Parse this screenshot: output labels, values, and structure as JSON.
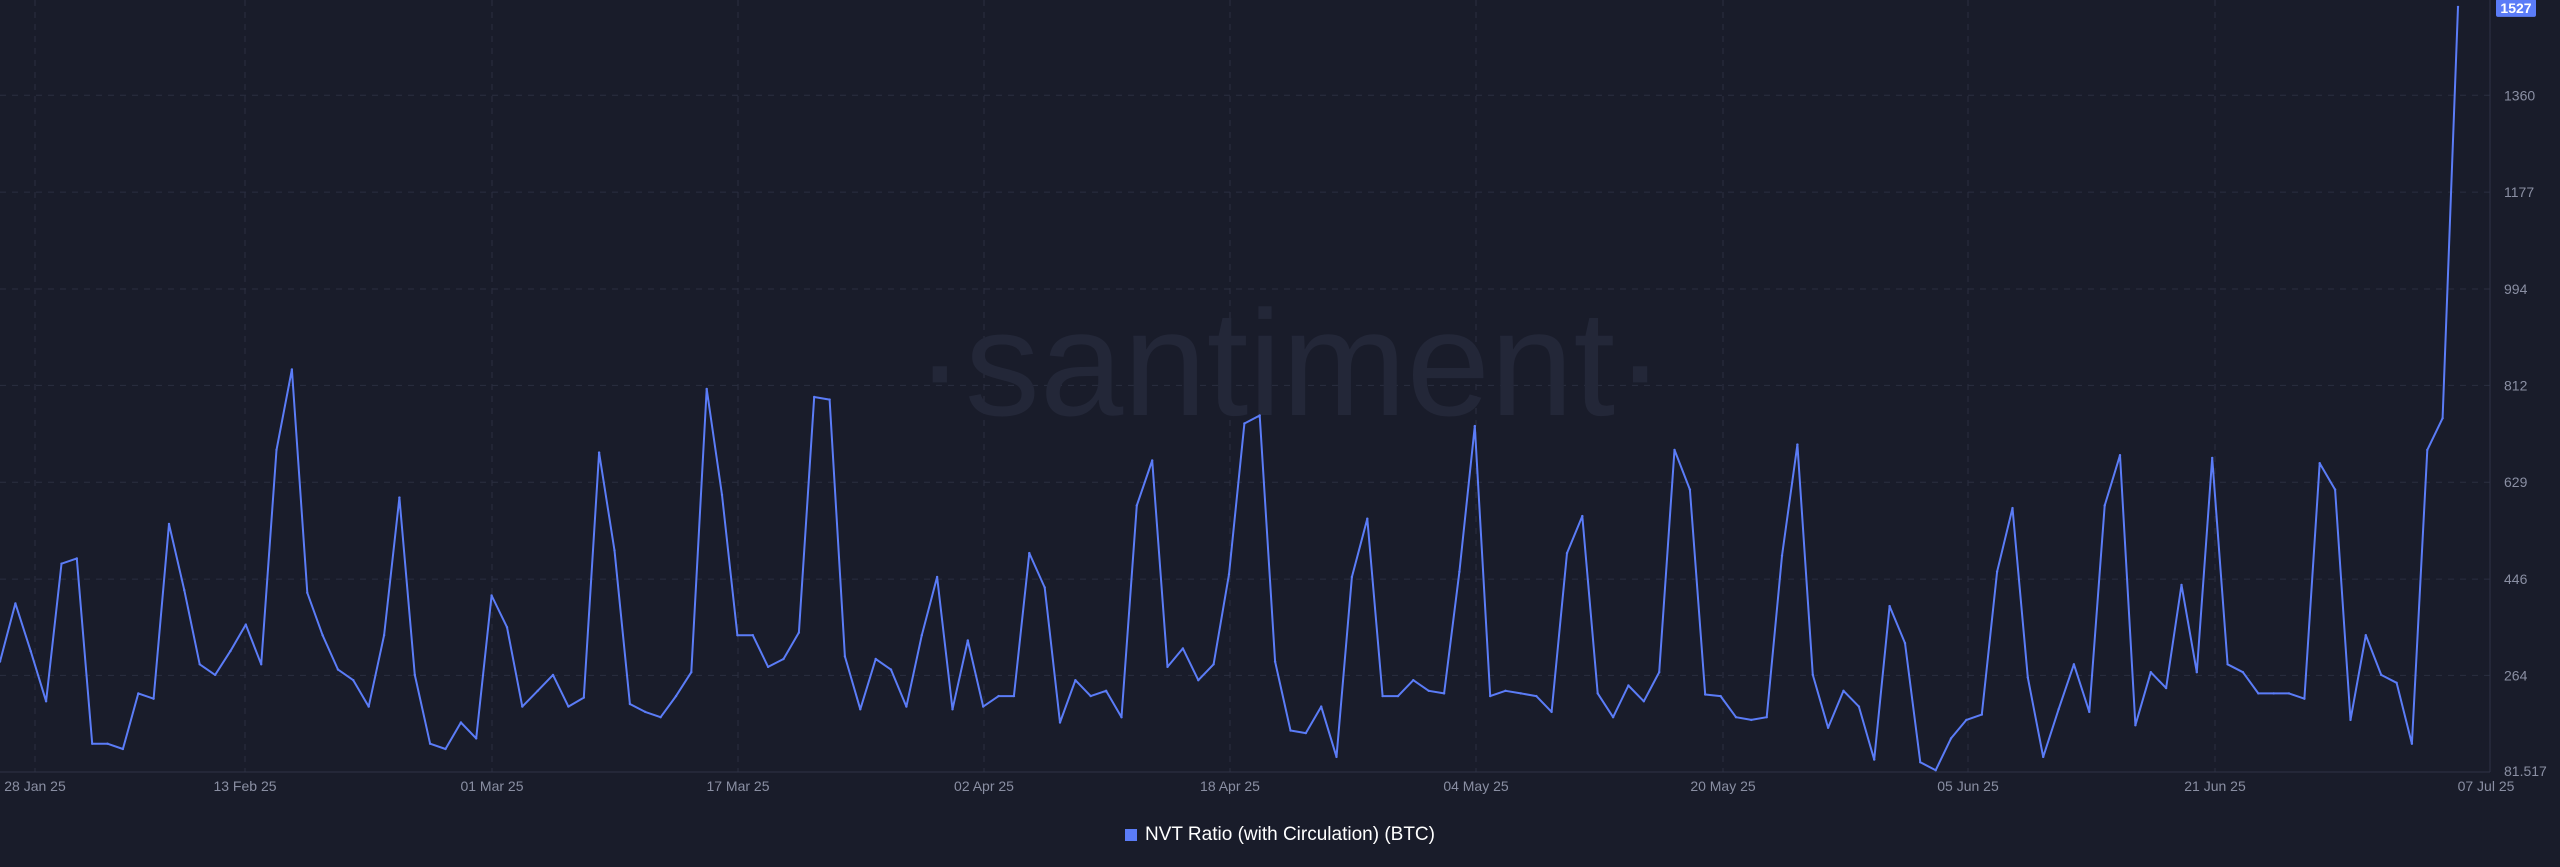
{
  "watermark": "·santiment·",
  "colors": {
    "background": "#191c2a",
    "line": "#5b7cf7",
    "grid": "#2a2e40",
    "axis_text": "#8a8fa3",
    "badge_bg": "#5b7cf7",
    "badge_text": "#ffffff"
  },
  "legend": {
    "label": "NVT Ratio (with Circulation) (BTC)"
  },
  "chart_data": {
    "type": "line",
    "title": "",
    "xlabel": "",
    "ylabel": "",
    "grid": true,
    "legend_position": "bottom-center",
    "ylim": [
      81.517,
      1540
    ],
    "y_ticks": [
      "81.517",
      "264",
      "446",
      "629",
      "812",
      "994",
      "1177",
      "1360"
    ],
    "x_ticks": [
      "28 Jan 25",
      "13 Feb 25",
      "01 Mar 25",
      "17 Mar 25",
      "02 Apr 25",
      "18 Apr 25",
      "04 May 25",
      "20 May 25",
      "05 Jun 25",
      "21 Jun 25",
      "07 Jul 25"
    ],
    "last_value_label": "1527",
    "series": [
      {
        "name": "NVT Ratio (with Circulation) (BTC)",
        "values": [
          290,
          400,
          310,
          215,
          475,
          485,
          135,
          135,
          125,
          230,
          220,
          550,
          425,
          285,
          265,
          310,
          360,
          285,
          690,
          842,
          420,
          340,
          275,
          255,
          205,
          340,
          600,
          265,
          135,
          125,
          175,
          145,
          415,
          355,
          205,
          235,
          265,
          205,
          222,
          685,
          500,
          210,
          195,
          185,
          225,
          270,
          805,
          605,
          340,
          340,
          280,
          295,
          345,
          790,
          785,
          300,
          200,
          295,
          275,
          205,
          340,
          450,
          200,
          330,
          205,
          225,
          225,
          495,
          430,
          175,
          255,
          225,
          235,
          185,
          585,
          670,
          280,
          315,
          255,
          285,
          455,
          740,
          755,
          290,
          160,
          155,
          205,
          110,
          450,
          560,
          225,
          225,
          255,
          235,
          230,
          460,
          735,
          225,
          235,
          230,
          225,
          195,
          495,
          565,
          230,
          185,
          245,
          215,
          270,
          690,
          615,
          228,
          225,
          185,
          180,
          185,
          490,
          700,
          265,
          165,
          235,
          205,
          105,
          395,
          325,
          100,
          85,
          145,
          180,
          190,
          460,
          580,
          260,
          110,
          200,
          285,
          195,
          585,
          680,
          170,
          270,
          240,
          435,
          270,
          675,
          285,
          270,
          230,
          230,
          230,
          220,
          665,
          615,
          180,
          340,
          265,
          250,
          135,
          690,
          750,
          1527
        ]
      }
    ]
  }
}
